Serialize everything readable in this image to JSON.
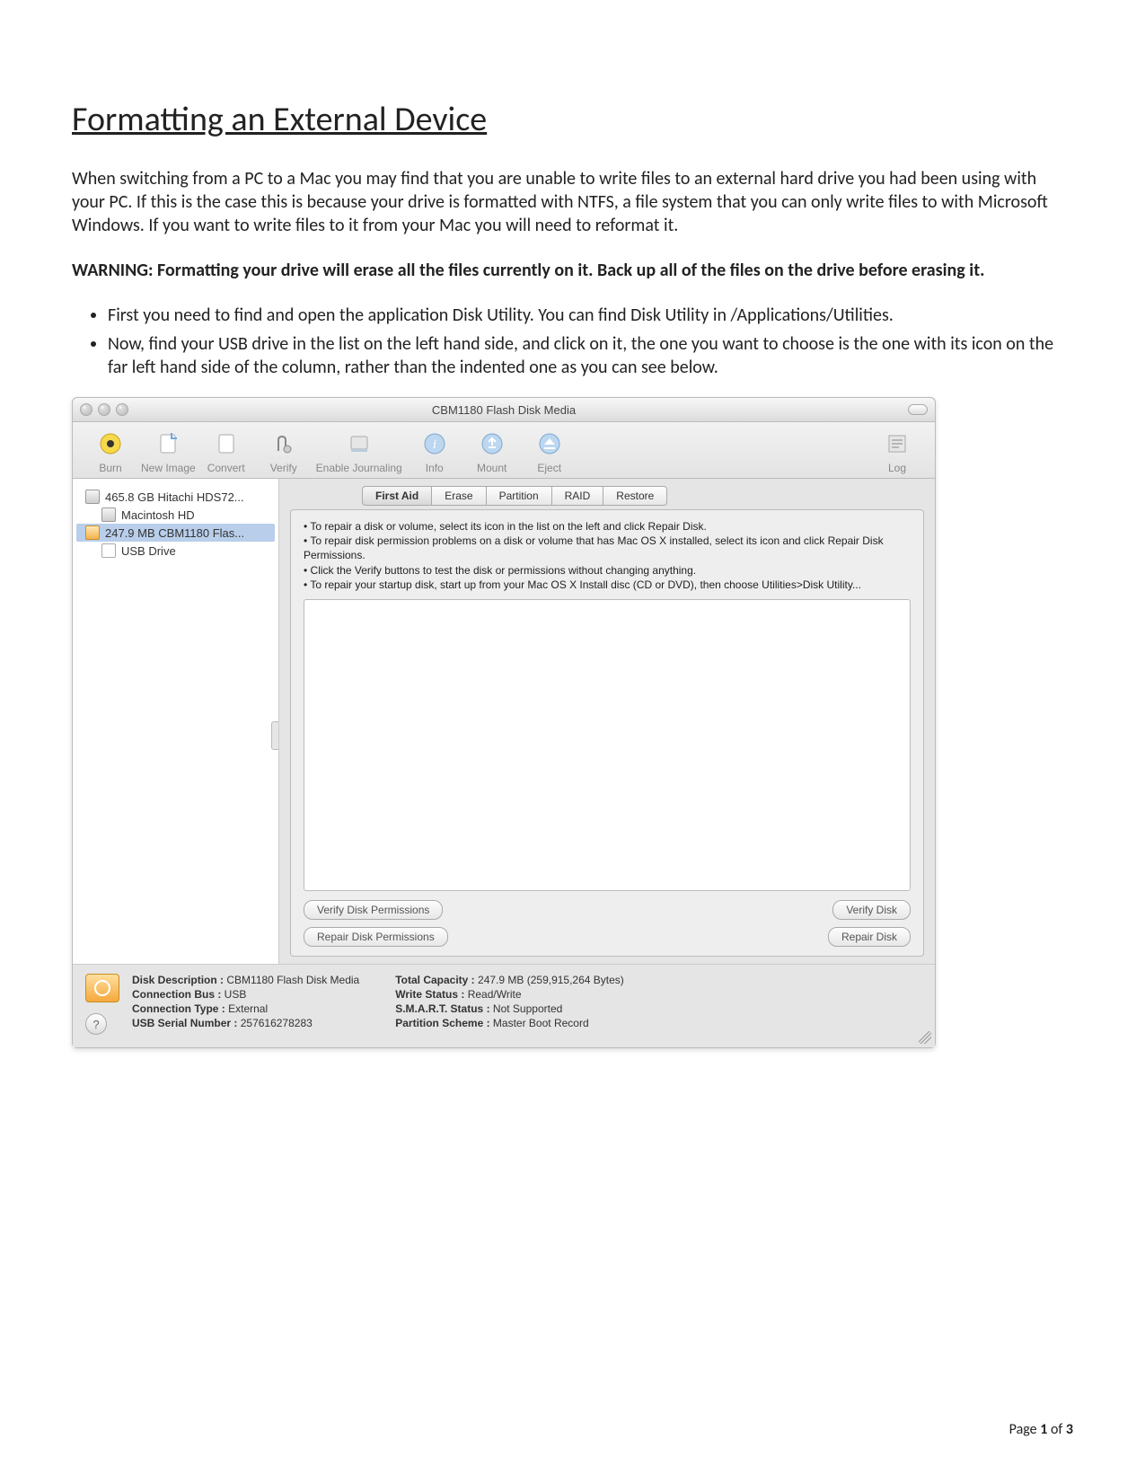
{
  "doc": {
    "title": "Formatting an External Device",
    "intro": "When switching from a PC to a Mac you may find that you are unable to write files to an external hard drive you had been using with your PC. If this is the case this is because your drive is formatted with NTFS, a file system that you can only write files to with Microsoft Windows. If you want to write files to it from your Mac you will need to reformat it.",
    "warning": "WARNING: Formatting your drive will erase all the files currently on it. Back up all of the files on the drive before erasing it.",
    "bullets": [
      "First you need to find and open the application Disk Utility. You can find Disk Utility in /Applications/Utilities.",
      "Now, find your USB drive in the list on the left hand side, and click on it, the one you want to choose is the one with its icon on the far left hand side of the column, rather than the indented one as you can see below."
    ]
  },
  "window": {
    "title": "CBM1180 Flash Disk Media",
    "toolbar": {
      "burn": "Burn",
      "new_image": "New Image",
      "convert": "Convert",
      "verify": "Verify",
      "enable_journaling": "Enable Journaling",
      "info": "Info",
      "mount": "Mount",
      "eject": "Eject",
      "log": "Log"
    },
    "sidebar": {
      "items": [
        {
          "label": "465.8 GB Hitachi HDS72...",
          "kind": "hdd"
        },
        {
          "label": "Macintosh HD",
          "kind": "vol"
        },
        {
          "label": "247.9 MB CBM1180 Flas...",
          "kind": "usb",
          "selected": true
        },
        {
          "label": "USB Drive",
          "kind": "vol2"
        }
      ]
    },
    "tabs": {
      "items": [
        "First Aid",
        "Erase",
        "Partition",
        "RAID",
        "Restore"
      ],
      "active": 0
    },
    "help": {
      "l1": "• To repair a disk or volume, select its icon in the list on the left and click Repair Disk.",
      "l2": "• To repair disk permission problems on a disk or volume that has Mac OS X installed, select its icon and click Repair Disk Permissions.",
      "l3": "• Click the Verify buttons to test the disk or permissions without changing anything.",
      "l4": "• To repair your startup disk, start up from your Mac OS X Install disc (CD or DVD), then choose Utilities>Disk Utility..."
    },
    "buttons": {
      "verify_perm": "Verify Disk Permissions",
      "repair_perm": "Repair Disk Permissions",
      "verify_disk": "Verify Disk",
      "repair_disk": "Repair Disk"
    },
    "info": {
      "desc_k": "Disk Description :",
      "desc_v": "CBM1180 Flash Disk Media",
      "bus_k": "Connection Bus :",
      "bus_v": "USB",
      "type_k": "Connection Type :",
      "type_v": "External",
      "serial_k": "USB Serial Number :",
      "serial_v": "257616278283",
      "cap_k": "Total Capacity :",
      "cap_v": "247.9 MB (259,915,264 Bytes)",
      "write_k": "Write Status :",
      "write_v": "Read/Write",
      "smart_k": "S.M.A.R.T. Status :",
      "smart_v": "Not Supported",
      "part_k": "Partition Scheme :",
      "part_v": "Master Boot Record"
    }
  },
  "footer": {
    "prefix": "Page ",
    "page": "1",
    "of": " of ",
    "total": "3"
  }
}
